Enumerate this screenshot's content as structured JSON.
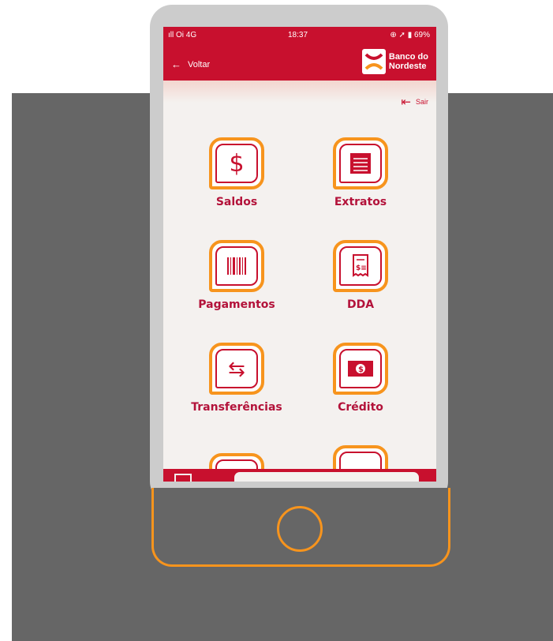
{
  "status_bar": {
    "left": "ıll Oi 4G",
    "time": "18:37",
    "right": "⊕ ➚ ▮ 69%"
  },
  "header": {
    "back_label": "Voltar",
    "brand_line1": "Banco do",
    "brand_line2": "Nordeste"
  },
  "logout": {
    "label": "Sair"
  },
  "menu": [
    {
      "label": "Saldos",
      "icon": "dollar-sign-icon"
    },
    {
      "label": "Extratos",
      "icon": "statement-icon"
    },
    {
      "label": "Pagamentos",
      "icon": "barcode-icon"
    },
    {
      "label": "DDA",
      "icon": "receipt-icon"
    },
    {
      "label": "Transferências",
      "icon": "transfer-arrows-icon"
    },
    {
      "label": "Crédito",
      "icon": "banknote-icon"
    }
  ],
  "colors": {
    "brand_red": "#c8102e",
    "accent_orange": "#f7941d",
    "label_red": "#b3123a",
    "bg_gray": "#666666"
  }
}
